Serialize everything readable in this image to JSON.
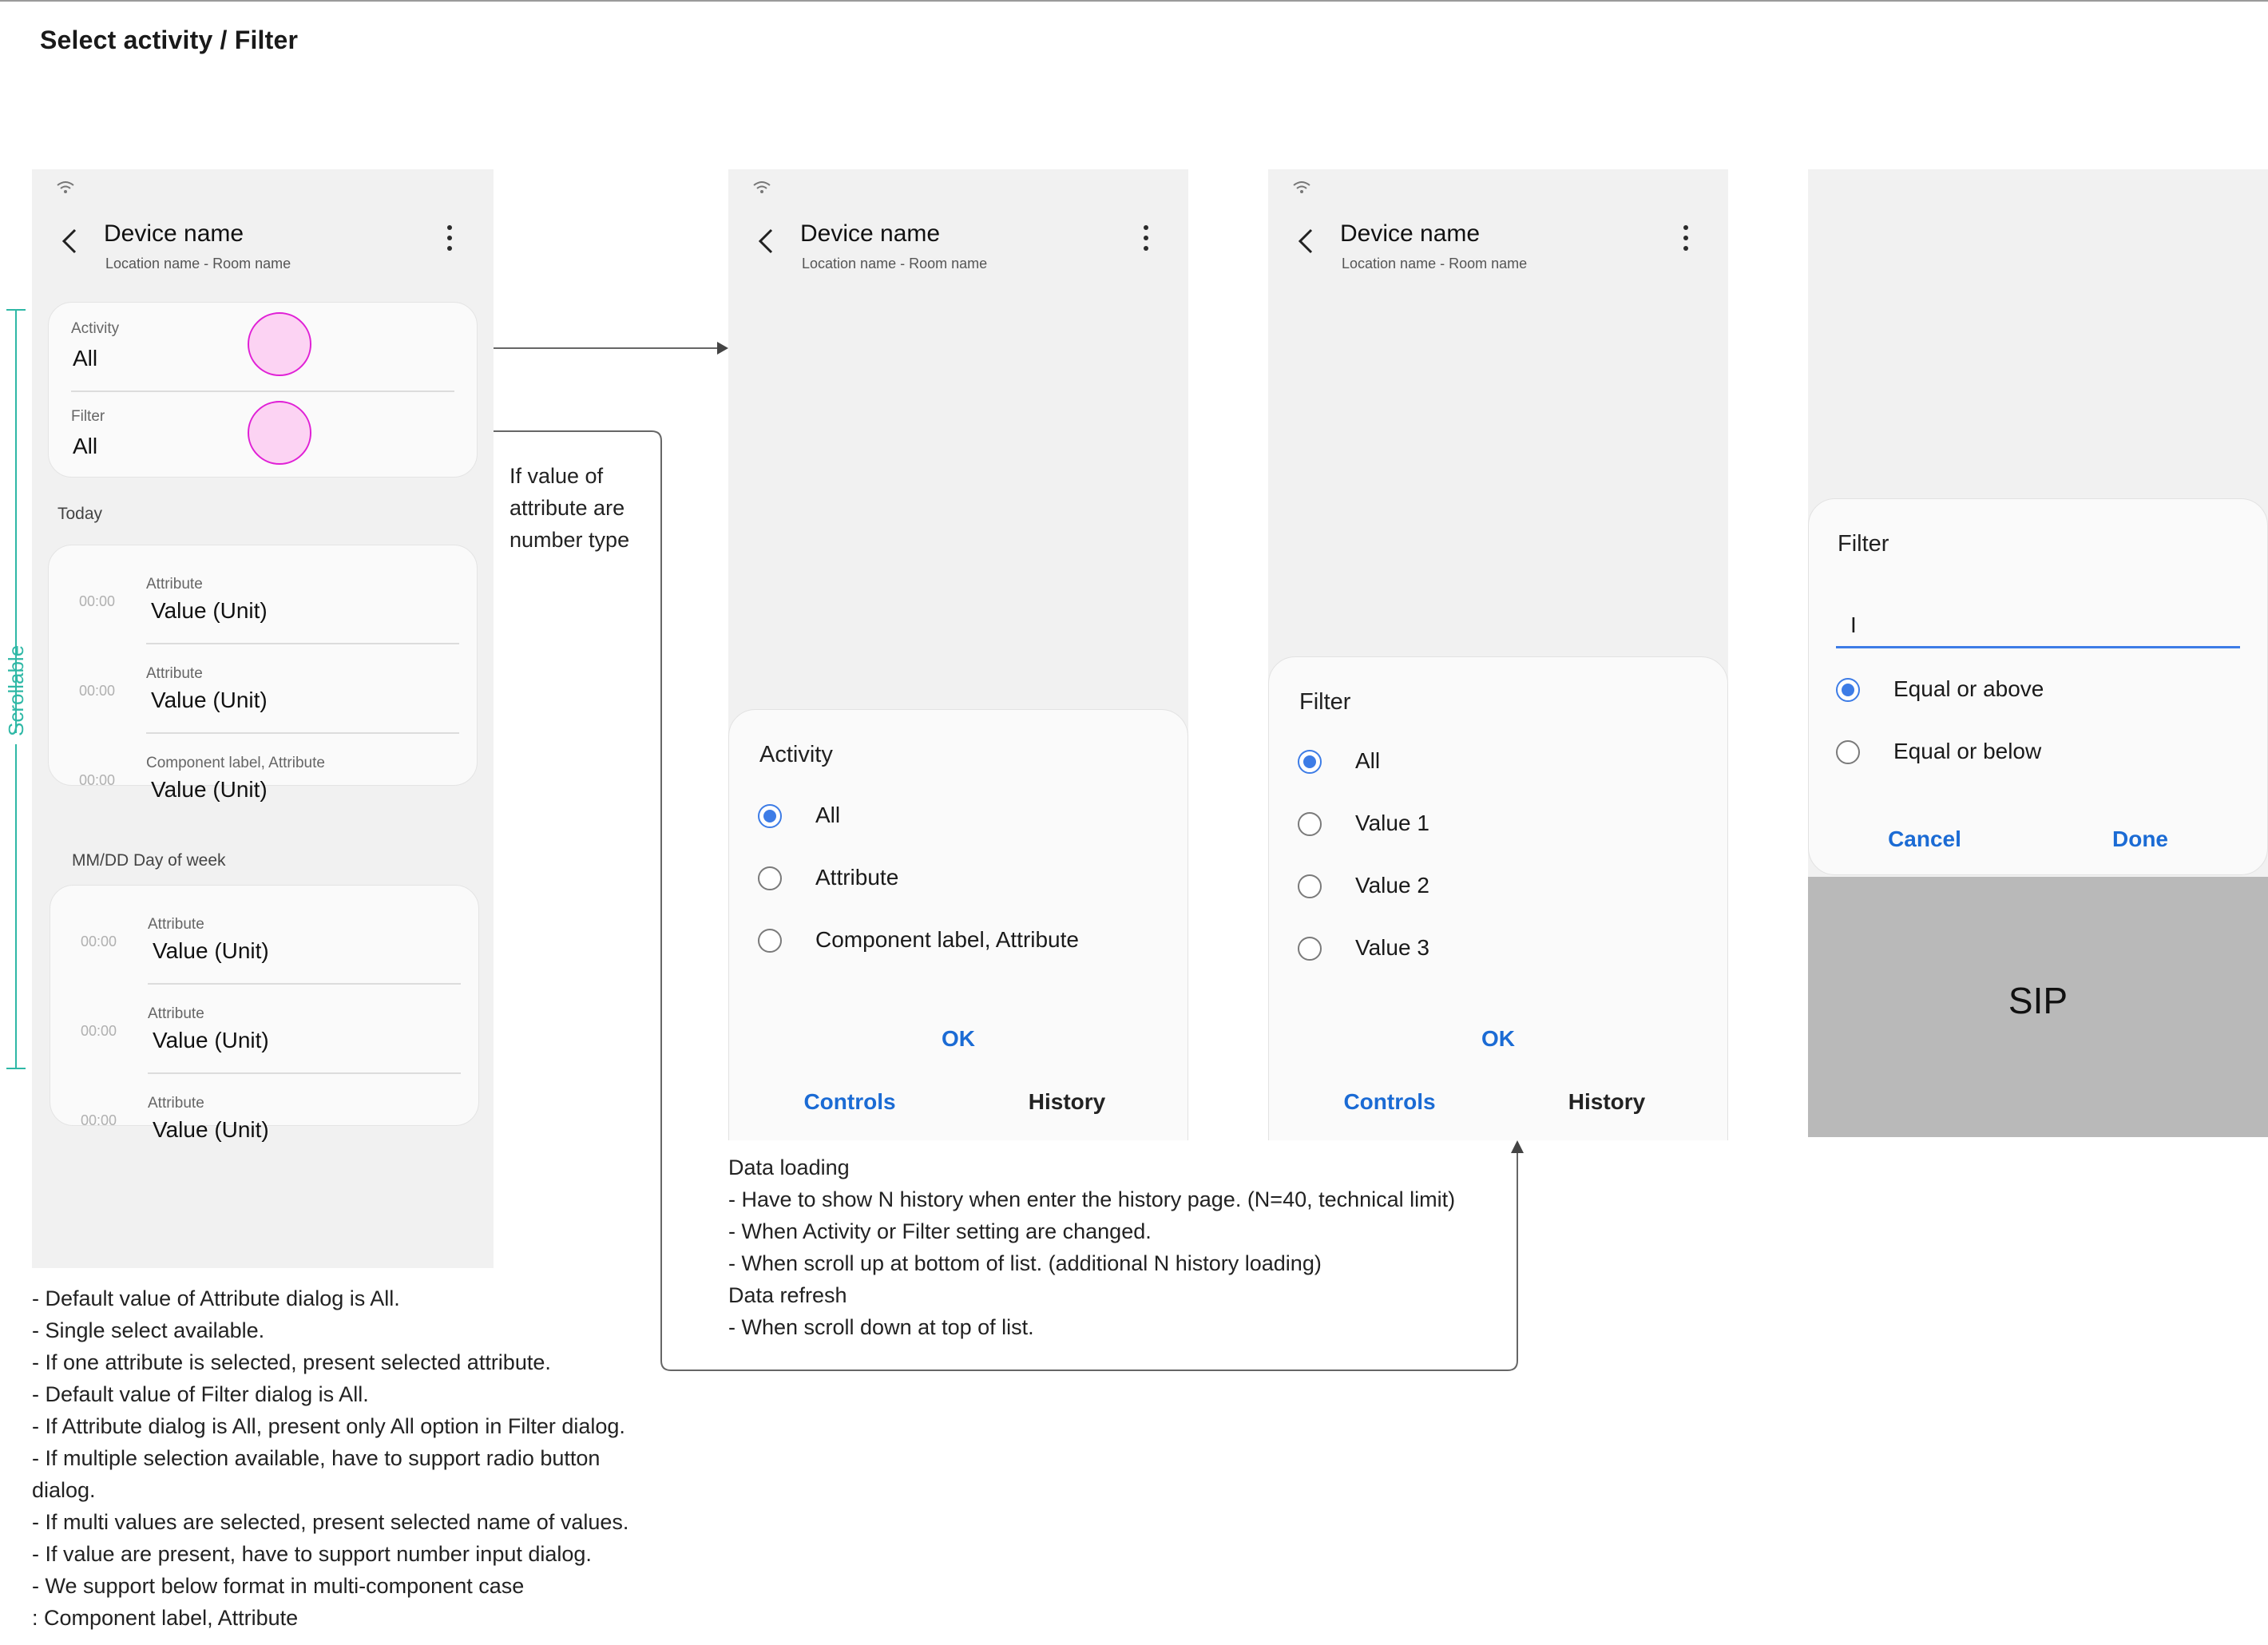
{
  "page": {
    "title": "Select activity / Filter"
  },
  "device": {
    "name": "Device name",
    "subtitle": "Location name - Room name"
  },
  "screen1": {
    "activity": {
      "label": "Activity",
      "value": "All"
    },
    "filter": {
      "label": "Filter",
      "value": "All"
    },
    "today_label": "Today",
    "today_items": [
      {
        "time": "00:00",
        "label": "Attribute",
        "value": "Value (Unit)"
      },
      {
        "time": "00:00",
        "label": "Attribute",
        "value": "Value (Unit)"
      },
      {
        "time": "00:00",
        "label": "Component label, Attribute",
        "value": "Value (Unit)"
      }
    ],
    "date_label": "MM/DD Day of week",
    "date_items": [
      {
        "time": "00:00",
        "label": "Attribute",
        "value": "Value (Unit)"
      },
      {
        "time": "00:00",
        "label": "Attribute",
        "value": "Value (Unit)"
      },
      {
        "time": "00:00",
        "label": "Attribute",
        "value": "Value (Unit)"
      }
    ]
  },
  "scrollable_label": "Scrollable",
  "annotation_number_type": [
    "If value of",
    "attribute are",
    "number type"
  ],
  "activity_dialog": {
    "title": "Activity",
    "options": [
      "All",
      "Attribute",
      "Component label, Attribute"
    ],
    "selected_index": 0,
    "ok": "OK"
  },
  "filter_dialog": {
    "title": "Filter",
    "options": [
      "All",
      "Value 1",
      "Value 2",
      "Value 3"
    ],
    "selected_index": 0,
    "ok": "OK"
  },
  "bottom_tabs": {
    "controls": "Controls",
    "history": "History"
  },
  "number_dialog": {
    "title": "Filter",
    "input_value": "I",
    "options": [
      "Equal or above",
      "Equal or below"
    ],
    "selected_index": 0,
    "cancel": "Cancel",
    "done": "Done",
    "sip": "SIP"
  },
  "data_loading_notes": [
    "Data loading",
    "- Have to show N history when enter the history page. (N=40, technical limit)",
    "- When Activity or Filter setting are changed.",
    "- When scroll up at bottom of list. (additional N history loading)",
    "Data refresh",
    "- When scroll down at top of list."
  ],
  "bottom_notes": [
    "- Default value of Attribute dialog is All.",
    "- Single select available.",
    "- If one attribute is selected, present selected attribute.",
    "- Default value of Filter dialog is All.",
    "- If Attribute dialog is All, present only All option in Filter dialog.",
    "- If multiple selection available, have to support radio button",
    "dialog.",
    "- If multi values are selected, present selected name of values.",
    "- If value are present, have to support number input dialog.",
    "- We support below format in multi-component case",
    ": Component label, Attribute"
  ],
  "colors": {
    "accent": "#1b6bd4",
    "radio": "#3d7ce6",
    "highlight_stroke": "#e020d6",
    "highlight_fill": "#fcd3f3",
    "scroll_marker": "#2fb8a6"
  }
}
